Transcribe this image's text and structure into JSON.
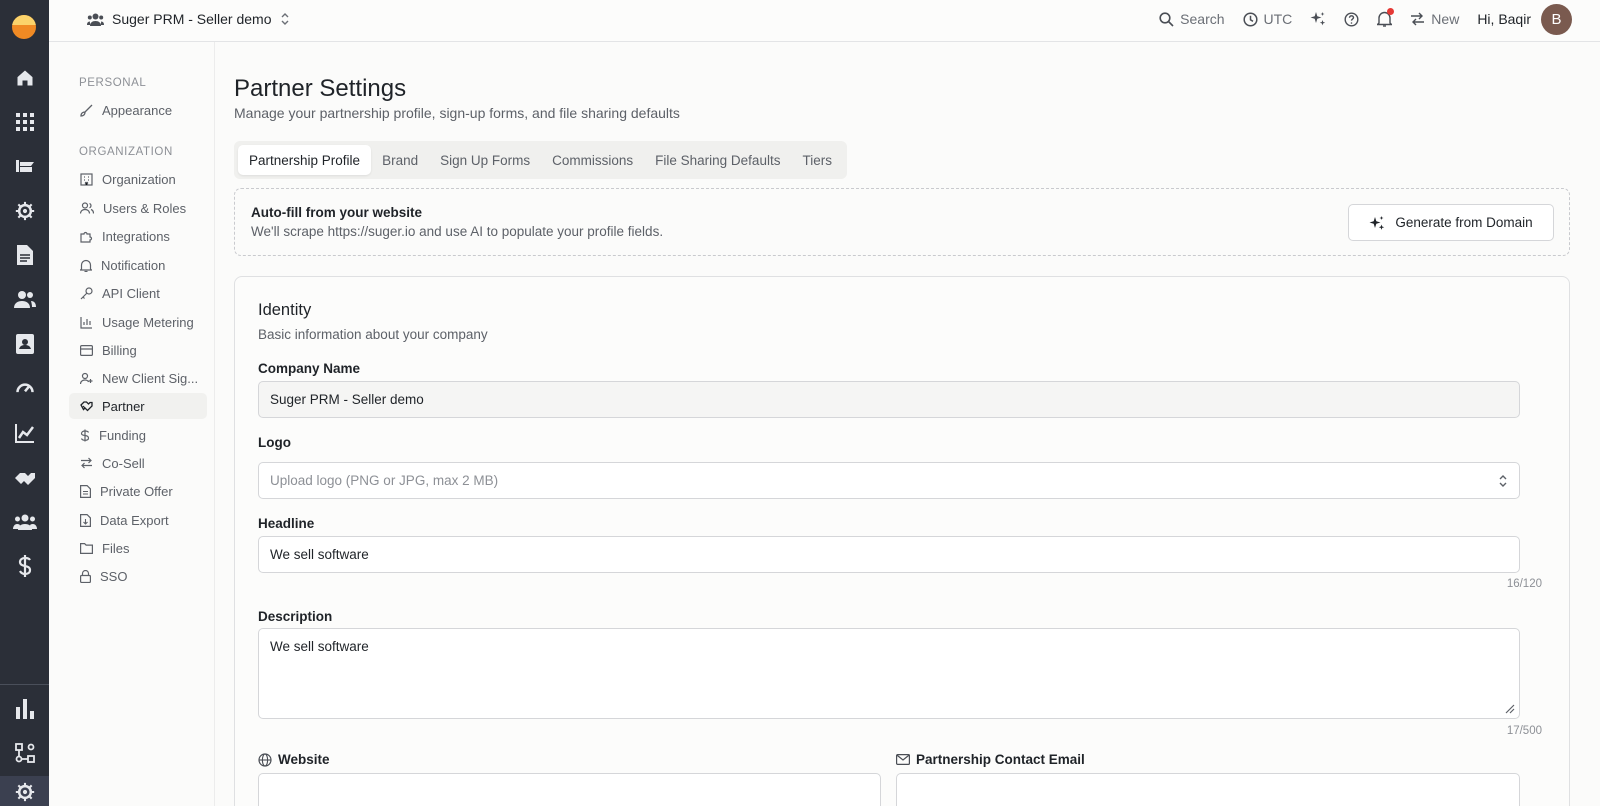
{
  "topbar": {
    "org_name": "Suger PRM - Seller demo",
    "search": "Search",
    "timezone": "UTC",
    "new": "New",
    "greeting": "Hi, Baqir",
    "avatar_initial": "B"
  },
  "settings_nav": {
    "personal_header": "PERSONAL",
    "personal_items": [
      {
        "label": "Appearance",
        "icon": "brush-icon"
      }
    ],
    "org_header": "ORGANIZATION",
    "org_items": [
      {
        "label": "Organization",
        "icon": "building-icon"
      },
      {
        "label": "Users & Roles",
        "icon": "users-icon"
      },
      {
        "label": "Integrations",
        "icon": "puzzle-icon"
      },
      {
        "label": "Notification",
        "icon": "bell-icon"
      },
      {
        "label": "API Client",
        "icon": "key-icon"
      },
      {
        "label": "Usage Metering",
        "icon": "bar-chart-icon"
      },
      {
        "label": "Billing",
        "icon": "credit-card-icon"
      },
      {
        "label": "New Client Sig...",
        "icon": "user-plus-icon"
      },
      {
        "label": "Partner",
        "icon": "handshake-icon",
        "active": true
      },
      {
        "label": "Funding",
        "icon": "dollar-icon"
      },
      {
        "label": "Co-Sell",
        "icon": "arrows-exchange-icon"
      },
      {
        "label": "Private Offer",
        "icon": "document-icon"
      },
      {
        "label": "Data Export",
        "icon": "file-export-icon"
      },
      {
        "label": "Files",
        "icon": "folder-icon"
      },
      {
        "label": "SSO",
        "icon": "lock-icon"
      }
    ]
  },
  "page": {
    "title": "Partner Settings",
    "subtitle": "Manage your partnership profile, sign-up forms, and file sharing defaults",
    "tabs": [
      "Partnership Profile",
      "Brand",
      "Sign Up Forms",
      "Commissions",
      "File Sharing Defaults",
      "Tiers"
    ],
    "active_tab": "Partnership Profile"
  },
  "autofill": {
    "title": "Auto-fill from your website",
    "description": "We'll scrape https://suger.io and use AI to populate your profile fields.",
    "button": "Generate from Domain"
  },
  "identity": {
    "title": "Identity",
    "subtitle": "Basic information about your company",
    "company_name_label": "Company Name",
    "company_name_value": "Suger PRM - Seller demo",
    "logo_label": "Logo",
    "logo_placeholder": "Upload logo (PNG or JPG, max 2 MB)",
    "headline_label": "Headline",
    "headline_value": "We sell software",
    "headline_counter": "16/120",
    "description_label": "Description",
    "description_value": "We sell software",
    "description_counter": "17/500",
    "website_label": "Website",
    "contact_email_label": "Partnership Contact Email"
  },
  "colors": {
    "rail_bg": "#2b2f38",
    "accent_logo": "#f08a24",
    "notification_dot": "#e53935"
  }
}
